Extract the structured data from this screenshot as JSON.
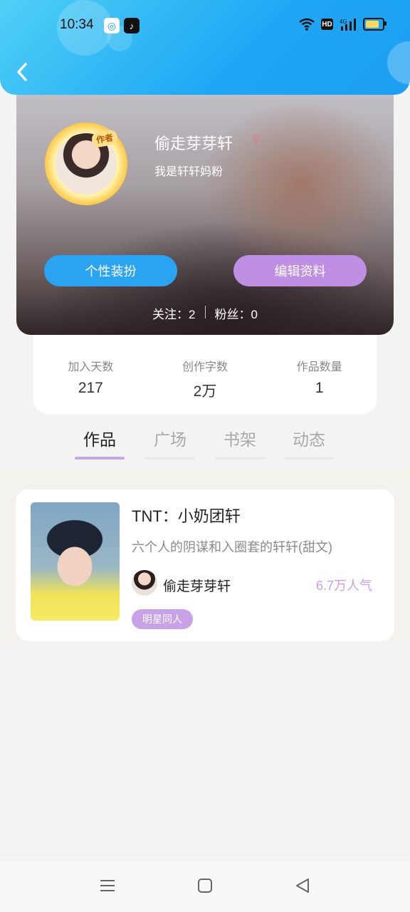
{
  "status_bar": {
    "time": "10:34",
    "network": "4G",
    "hd_badge": "HD",
    "battery_level": 0.7
  },
  "colors": {
    "header_blue": "#1fa6f4",
    "button_blue": "#2aa4f0",
    "button_purple": "#be8fe2",
    "accent_purple": "#c9a0ea"
  },
  "profile": {
    "author_badge": "作者",
    "name": "偷走芽芽轩",
    "gender_symbol": "♀",
    "bio": "我是轩轩妈粉",
    "btn_dress": "个性装扮",
    "btn_edit": "编辑资料",
    "follow": "关注：2",
    "fans": "粉丝：0"
  },
  "stats": [
    {
      "label": "加入天数",
      "value": "217"
    },
    {
      "label": "创作字数",
      "value": "2万"
    },
    {
      "label": "作品数量",
      "value": "1"
    }
  ],
  "tabs": [
    {
      "label": "作品",
      "active": true
    },
    {
      "label": "广场",
      "active": false
    },
    {
      "label": "书架",
      "active": false
    },
    {
      "label": "动态",
      "active": false
    }
  ],
  "work": {
    "title": "TNT：小奶团轩",
    "description": "六个人的阴谋和入圈套的轩轩(甜文)",
    "author": "偷走芽芽轩",
    "popularity": "6.7万人气",
    "tag": "明星同人"
  },
  "icons": {
    "back": "back-arrow-icon",
    "menu": "menu-icon",
    "home": "home-square-icon",
    "back_nav": "back-triangle-icon"
  }
}
